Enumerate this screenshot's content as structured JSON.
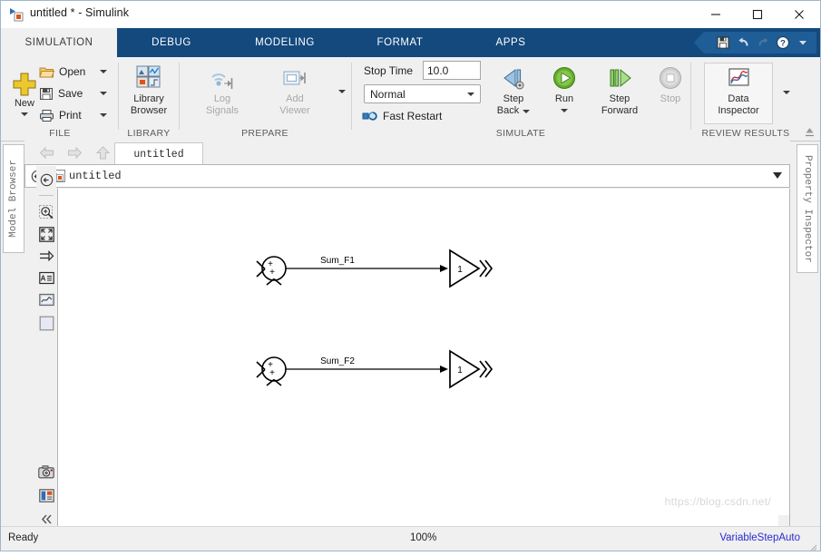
{
  "window": {
    "title": "untitled * - Simulink",
    "app_icon": "simulink-icon",
    "controls": {
      "minimize": "minimize-icon",
      "maximize": "maximize-icon",
      "close": "close-icon"
    }
  },
  "tabs": [
    {
      "label": "SIMULATION",
      "active": true
    },
    {
      "label": "DEBUG",
      "active": false
    },
    {
      "label": "MODELING",
      "active": false
    },
    {
      "label": "FORMAT",
      "active": false
    },
    {
      "label": "APPS",
      "active": false
    }
  ],
  "quick_access": [
    {
      "name": "save-icon",
      "enabled": true
    },
    {
      "name": "undo-icon",
      "enabled": true
    },
    {
      "name": "redo-icon",
      "enabled": false
    },
    {
      "name": "help-icon",
      "enabled": true
    },
    {
      "name": "chevron-down-icon",
      "enabled": true
    }
  ],
  "ribbon": {
    "groups": [
      {
        "id": "file",
        "label": "FILE"
      },
      {
        "id": "library",
        "label": "LIBRARY"
      },
      {
        "id": "prepare",
        "label": "PREPARE"
      },
      {
        "id": "simulate",
        "label": "SIMULATE"
      },
      {
        "id": "review",
        "label": "REVIEW RESULTS"
      }
    ],
    "file": {
      "new_label": "New",
      "open_label": "Open",
      "save_label": "Save",
      "print_label": "Print"
    },
    "library": {
      "line1": "Library",
      "line2": "Browser"
    },
    "prepare": {
      "log_signals_line1": "Log",
      "log_signals_line2": "Signals",
      "add_viewer_line1": "Add",
      "add_viewer_line2": "Viewer"
    },
    "simulate": {
      "stop_time_label": "Stop Time",
      "stop_time_value": "10.0",
      "mode_value": "Normal",
      "fast_restart_label": "Fast Restart",
      "step_back_line1": "Step",
      "step_back_line2": "Back",
      "run_label": "Run",
      "step_fwd_line1": "Step",
      "step_fwd_line2": "Forward",
      "stop_label": "Stop"
    },
    "review": {
      "line1": "Data",
      "line2": "Inspector"
    }
  },
  "navigation": {
    "back": "back-arrow-icon",
    "forward": "forward-arrow-icon",
    "up": "up-arrow-icon",
    "model_tab": "untitled"
  },
  "breadcrumb": {
    "icon": "simulink-model-icon",
    "text": "untitled"
  },
  "side_panels": {
    "left_tab": "Model Browser",
    "right_tab": "Property Inspector"
  },
  "canvas_tools": [
    {
      "name": "navigate-back-icon"
    },
    {
      "name": "zoom-in-icon"
    },
    {
      "name": "fit-to-view-icon"
    },
    {
      "name": "signal-ports-icon"
    },
    {
      "name": "annotation-icon"
    },
    {
      "name": "scope-viewer-icon"
    },
    {
      "name": "area-box-icon"
    },
    {
      "name": "camera-snapshot-icon"
    },
    {
      "name": "report-icon"
    },
    {
      "name": "collapse-toolbar-icon"
    }
  ],
  "diagram": {
    "blocks": [
      {
        "id": "row1",
        "sum_block": {
          "type": "sum",
          "signs": [
            "+",
            "+"
          ]
        },
        "signal_label": "Sum_F1",
        "gain_block": {
          "type": "gain",
          "value": "1"
        }
      },
      {
        "id": "row2",
        "sum_block": {
          "type": "sum",
          "signs": [
            "+",
            "+"
          ]
        },
        "signal_label": "Sum_F2",
        "gain_block": {
          "type": "gain",
          "value": "1"
        }
      }
    ]
  },
  "status_bar": {
    "ready": "Ready",
    "zoom": "100%",
    "solver": "VariableStepAuto"
  },
  "watermark": "https://blog.csdn.net/",
  "colors": {
    "ribbon_blue": "#13497d",
    "accent_green": "#5aa32a",
    "solver_text": "#2a2ad0",
    "new_yellow": "#e8c423"
  }
}
